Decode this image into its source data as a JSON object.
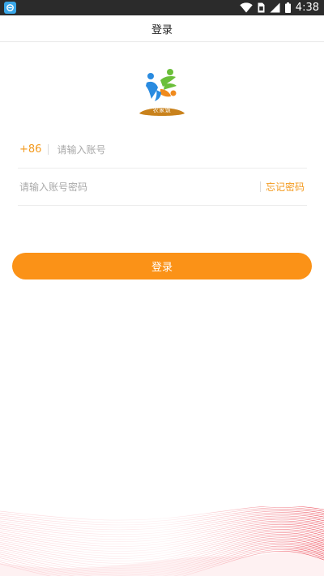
{
  "status_bar": {
    "time": "4:38"
  },
  "header": {
    "title": "登录"
  },
  "logo": {
    "badge_text": "农家饭"
  },
  "account": {
    "country_code": "+86",
    "placeholder": "请输入账号",
    "value": ""
  },
  "password": {
    "placeholder": "请输入账号密码",
    "value": "",
    "forgot_label": "忘记密码"
  },
  "login": {
    "label": "登录"
  },
  "colors": {
    "accent": "#fb9217",
    "accent_text": "#f39a1e",
    "status_bar": "#2b2b2b",
    "decor": "#f26b7a"
  },
  "icons": {
    "status_app": "app-notification-icon",
    "wifi": "wifi-icon",
    "sim": "sim-icon",
    "signal": "signal-icon",
    "battery": "battery-icon"
  }
}
